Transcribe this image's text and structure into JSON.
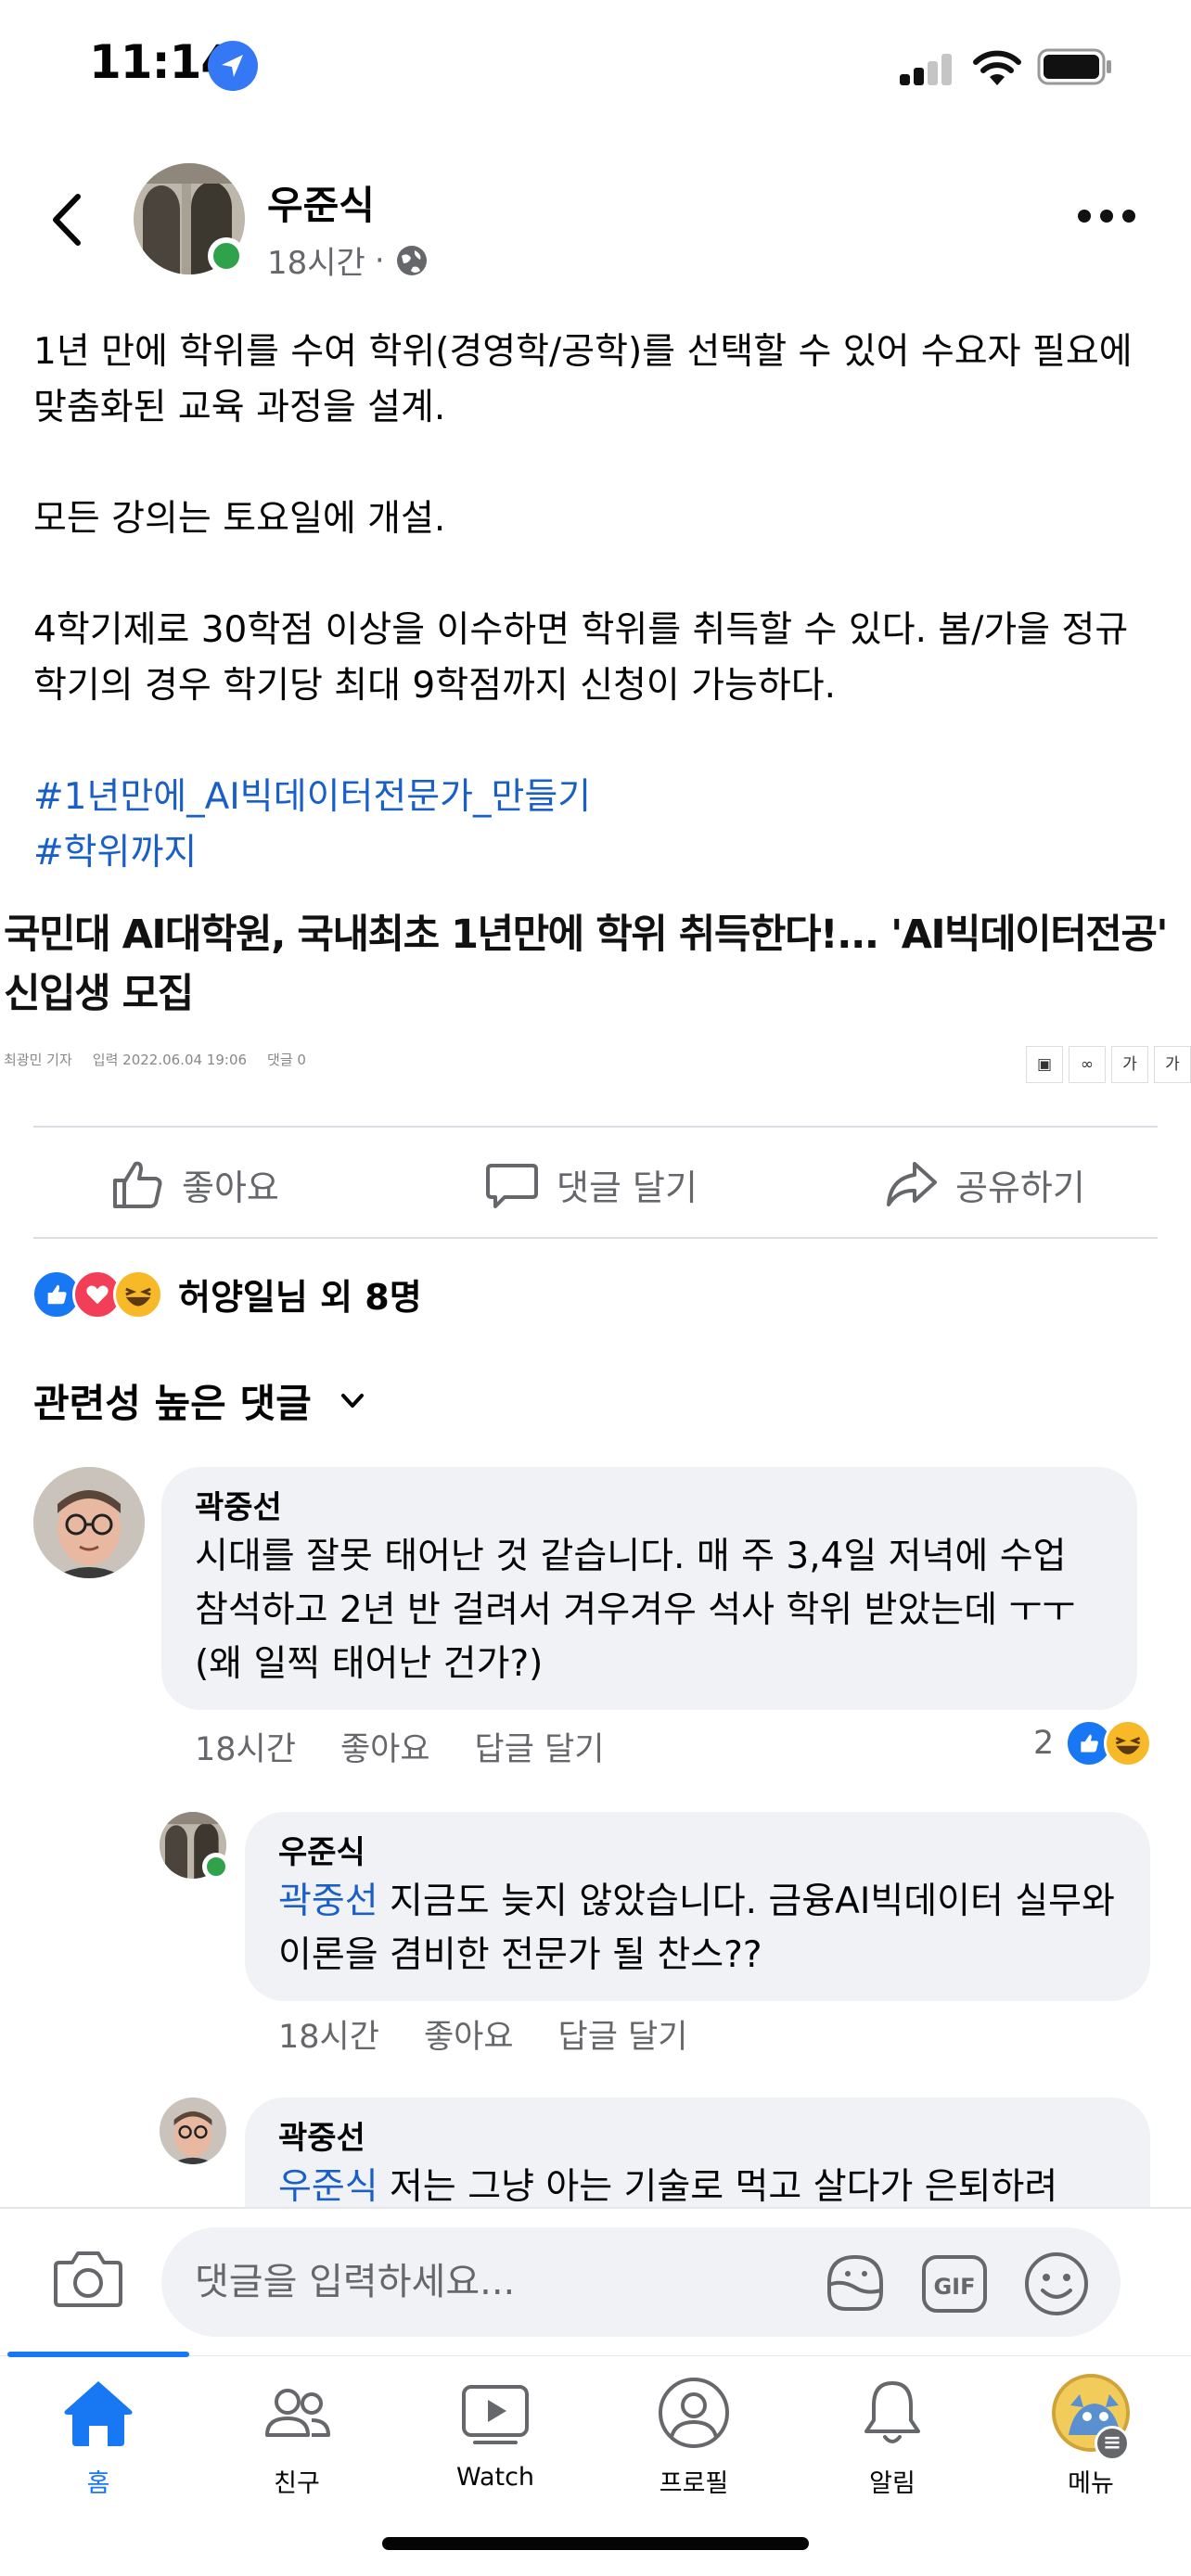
{
  "status_bar": {
    "time": "11:14"
  },
  "post": {
    "author": "우준식",
    "time": "18시간",
    "separator": "·",
    "paragraphs": [
      "1년 만에 학위를 수여 학위(경영학/공학)를 선택할 수 있어 수요자 필요에 맞춤화된 교육 과정을 설계.",
      "모든 강의는 토요일에 개설.",
      "4학기제로 30학점 이상을 이수하면 학위를 취득할 수 있다. 봄/가을 정규 학기의 경우 학기당 최대 9학점까지 신청이 가능하다."
    ],
    "hashtags": [
      "#1년만에_AI빅데이터전문가_만들기",
      "#학위까지"
    ]
  },
  "article": {
    "title": "국민대 AI대학원, 국내최초 1년만에 학위 취득한다!... 'AI빅데이터전공' 신입생 모집",
    "reporter": "최광민 기자",
    "date": "입력 2022.06.04 19:06",
    "comments": "댓글 0",
    "tools": [
      "가",
      "가"
    ]
  },
  "actions": {
    "like": "좋아요",
    "comment": "댓글 달기",
    "share": "공유하기"
  },
  "reactions": {
    "summary": "허양일님 외 8명"
  },
  "comments_sort": "관련성 높은 댓글",
  "comments": [
    {
      "name": "곽중선",
      "text": "시대를 잘못 태어난 것 같습니다. 매 주 3,4일 저녁에 수업 참석하고 2년 반 걸려서 겨우겨우 석사 학위 받았는데 ㅜㅜ (왜 일찍 태어난 건가?)",
      "time": "18시간",
      "like": "좋아요",
      "reply": "답글 달기",
      "reaction_count": "2"
    },
    {
      "name": "우준식",
      "mention": "곽중선",
      "text": " 지금도 늦지 않았습니다.  금융AI빅데이터 실무와 이론을 겸비한 전문가 될 찬스??",
      "time": "18시간",
      "like": "좋아요",
      "reply": "답글 달기"
    },
    {
      "name": "곽중선",
      "mention": "우준식",
      "text": " 저는 그냥 아는 기술로 먹고 살다가 은퇴하려"
    }
  ],
  "composer": {
    "placeholder": "댓글을 입력하세요..."
  },
  "tabs": [
    {
      "label": "홈",
      "icon": "home-icon",
      "active": true
    },
    {
      "label": "친구",
      "icon": "friends-icon"
    },
    {
      "label": "Watch",
      "icon": "watch-icon"
    },
    {
      "label": "프로필",
      "icon": "profile-icon"
    },
    {
      "label": "알림",
      "icon": "bell-icon"
    },
    {
      "label": "메뉴",
      "icon": "menu-avatar-icon"
    }
  ],
  "colors": {
    "accent": "#1877f2",
    "link": "#1a5fc8",
    "muted": "#65676b",
    "bubble": "#f0f2f5"
  }
}
